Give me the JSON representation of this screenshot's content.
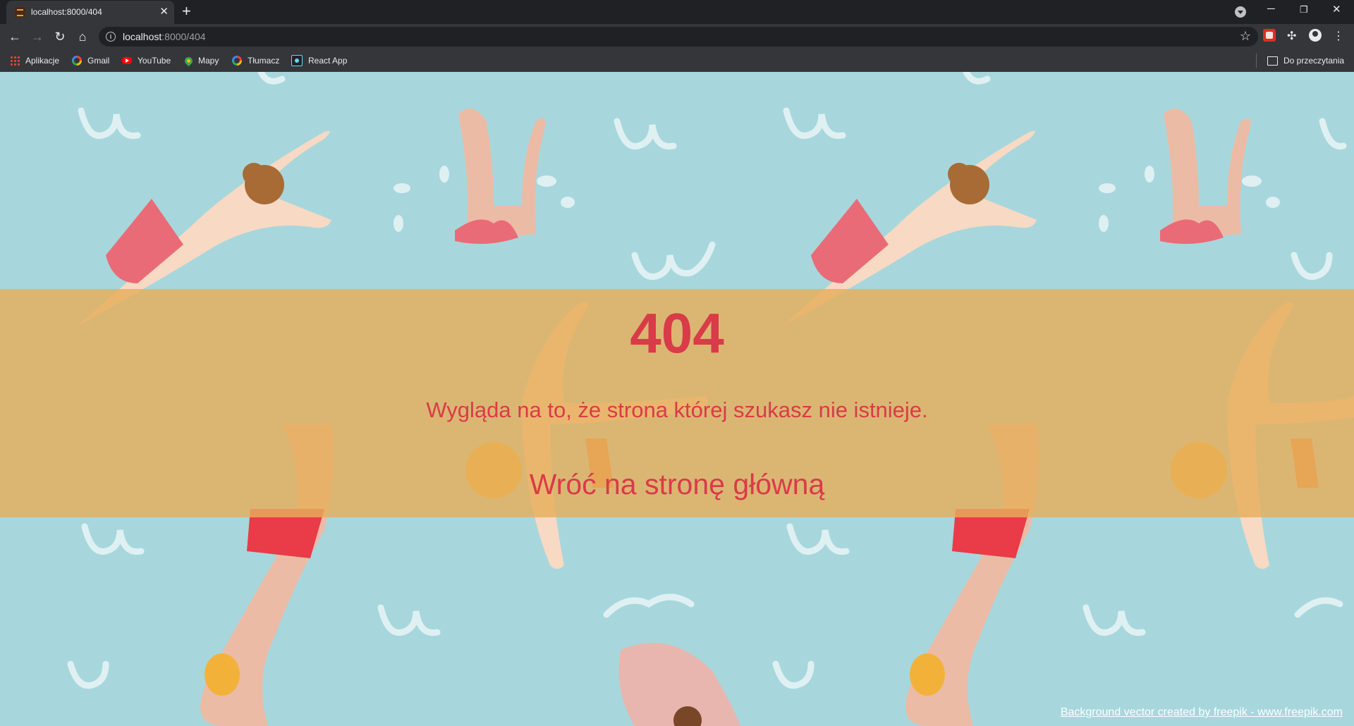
{
  "browser": {
    "tab": {
      "title": "localhost:8000/404"
    },
    "url": {
      "host": "localhost",
      "path": ":8000/404"
    },
    "bookmarks": [
      {
        "label": "Aplikacje",
        "icon": "apps-grid-icon"
      },
      {
        "label": "Gmail",
        "icon": "google-icon"
      },
      {
        "label": "YouTube",
        "icon": "youtube-icon"
      },
      {
        "label": "Mapy",
        "icon": "maps-icon"
      },
      {
        "label": "Tłumacz",
        "icon": "google-icon"
      },
      {
        "label": "React App",
        "icon": "react-icon"
      }
    ],
    "reading_list": "Do przeczytania"
  },
  "page": {
    "error_code": "404",
    "message": "Wygląda na to, że strona której szukasz nie istnieje.",
    "home_link": "Wróć na stronę główną",
    "credit": "Background vector created by freepik - www.freepik.com"
  },
  "colors": {
    "background": "#a7d7dc",
    "banner": "#e6ae5c",
    "text": "#d93b48"
  }
}
